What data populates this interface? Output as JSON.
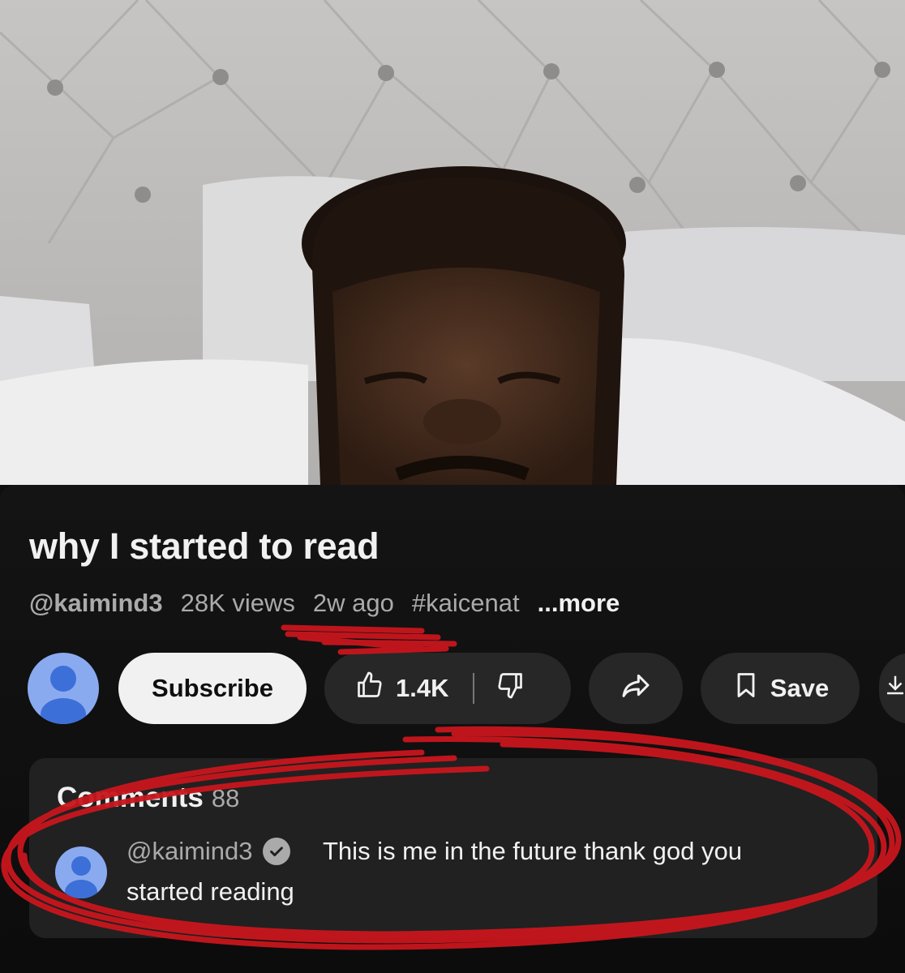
{
  "video": {
    "title": "why I started to read",
    "channel_handle": "@kaimind3",
    "views": "28K views",
    "age": "2w ago",
    "hashtag": "#kaicenat",
    "more_label": "...more"
  },
  "actions": {
    "subscribe_label": "Subscribe",
    "like_count": "1.4K",
    "save_label": "Save"
  },
  "comments": {
    "heading": "Comments",
    "count": "88",
    "top_comment": {
      "author": "@kaimind3",
      "verified": true,
      "text_line1": "This is me in the future thank god you",
      "text_line2": "started reading"
    }
  },
  "colors": {
    "background": "#0f0f0f",
    "subscribe_bg": "#f1f1f1",
    "pill_bg": "#272727",
    "avatar": "#8aaaf0",
    "annotation_red": "#c8161d"
  }
}
